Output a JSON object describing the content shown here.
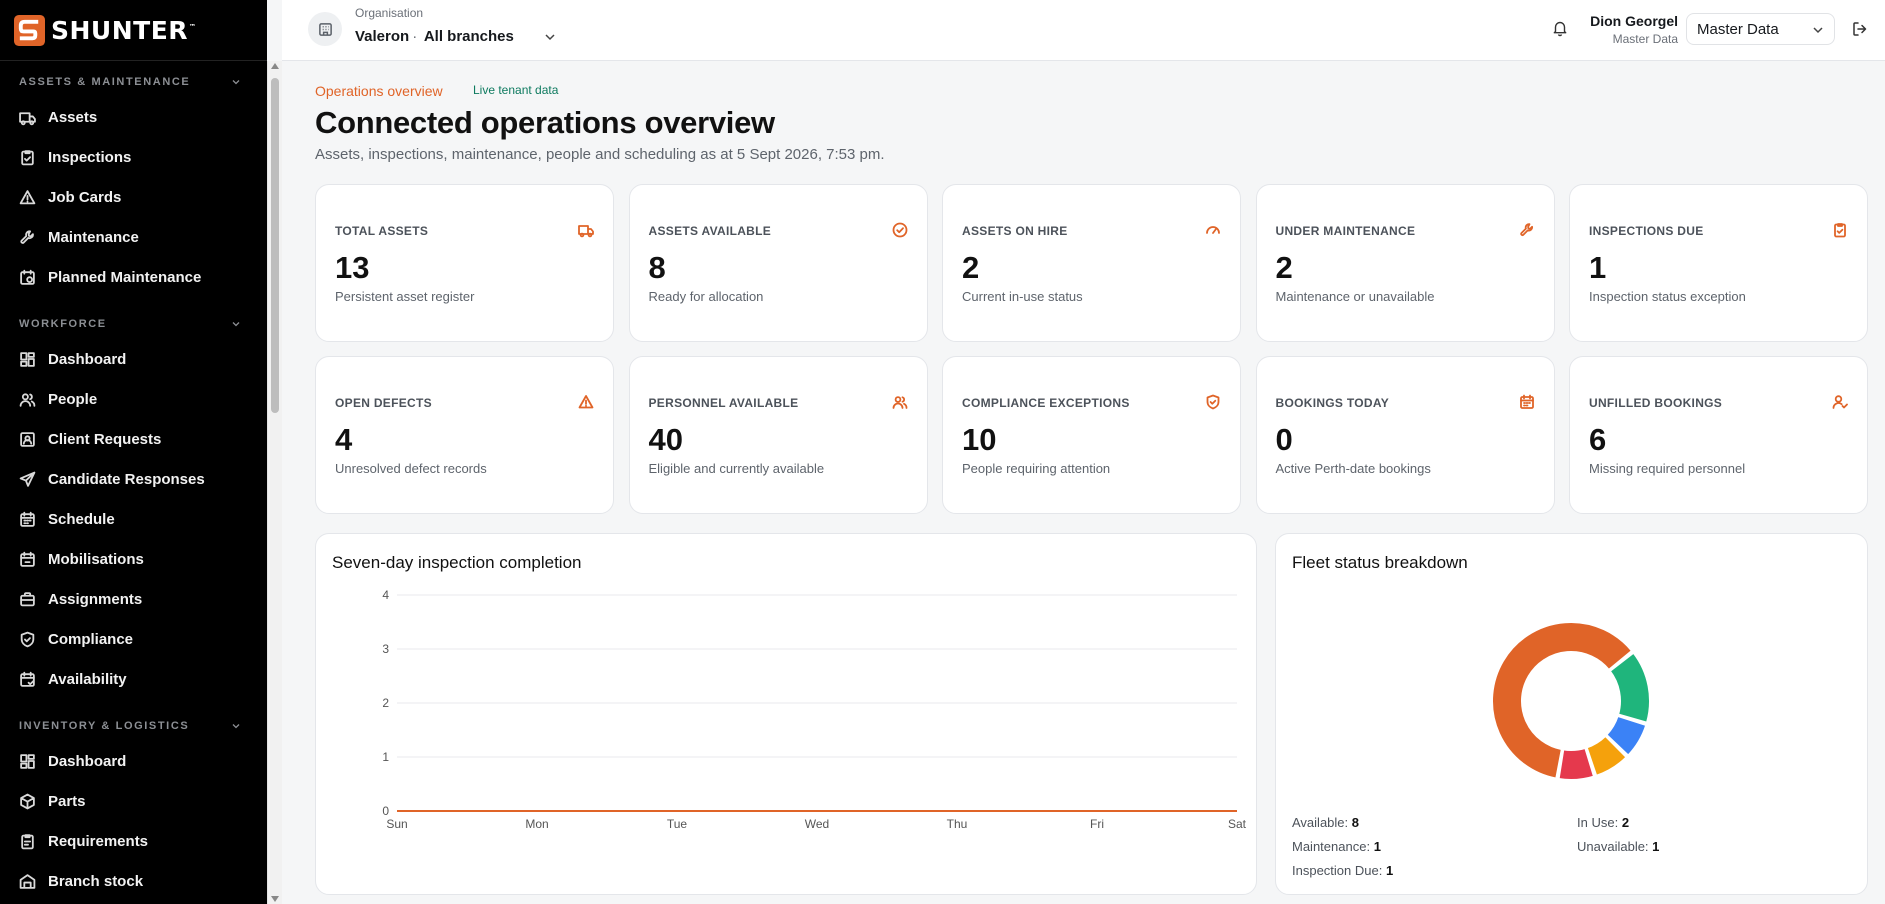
{
  "brand": {
    "name": "SHUNTER",
    "tm": "™",
    "accent": "#e06428"
  },
  "topbar": {
    "org_label": "Organisation",
    "org_name": "Valeron",
    "org_separator": "·",
    "branch": "All branches",
    "user_name": "Dion Georgel",
    "user_role": "Master Data",
    "role_selected": "Master Data"
  },
  "sidebar": {
    "sections": [
      {
        "title": "ASSETS & MAINTENANCE",
        "items": [
          "Assets",
          "Inspections",
          "Job Cards",
          "Maintenance",
          "Planned Maintenance"
        ]
      },
      {
        "title": "WORKFORCE",
        "items": [
          "Dashboard",
          "People",
          "Client Requests",
          "Candidate Responses",
          "Schedule",
          "Mobilisations",
          "Assignments",
          "Compliance",
          "Availability"
        ]
      },
      {
        "title": "INVENTORY & LOGISTICS",
        "items": [
          "Dashboard",
          "Parts",
          "Requirements",
          "Branch stock"
        ]
      }
    ]
  },
  "header": {
    "eyebrow": "Operations overview",
    "badge": "Live tenant data",
    "title": "Connected operations overview",
    "subtitle": "Assets, inspections, maintenance, people and scheduling as at 5 Sept 2026, 7:53 pm."
  },
  "stats": [
    {
      "label": "TOTAL ASSETS",
      "value": "13",
      "desc": "Persistent asset register",
      "icon": "truck-icon"
    },
    {
      "label": "ASSETS AVAILABLE",
      "value": "8",
      "desc": "Ready for allocation",
      "icon": "check-circle-icon"
    },
    {
      "label": "ASSETS ON HIRE",
      "value": "2",
      "desc": "Current in-use status",
      "icon": "gauge-icon"
    },
    {
      "label": "UNDER MAINTENANCE",
      "value": "2",
      "desc": "Maintenance or unavailable",
      "icon": "wrench-icon"
    },
    {
      "label": "INSPECTIONS DUE",
      "value": "1",
      "desc": "Inspection status exception",
      "icon": "clipboard-icon"
    },
    {
      "label": "OPEN DEFECTS",
      "value": "4",
      "desc": "Unresolved defect records",
      "icon": "warning-icon"
    },
    {
      "label": "PERSONNEL AVAILABLE",
      "value": "40",
      "desc": "Eligible and currently available",
      "icon": "users-icon"
    },
    {
      "label": "COMPLIANCE EXCEPTIONS",
      "value": "10",
      "desc": "People requiring attention",
      "icon": "shield-icon"
    },
    {
      "label": "BOOKINGS TODAY",
      "value": "0",
      "desc": "Active Perth-date bookings",
      "icon": "calendar-icon"
    },
    {
      "label": "UNFILLED BOOKINGS",
      "value": "6",
      "desc": "Missing required personnel",
      "icon": "user-check-icon"
    }
  ],
  "chart_data": [
    {
      "type": "line",
      "title": "Seven-day inspection completion",
      "categories": [
        "Sun",
        "Mon",
        "Tue",
        "Wed",
        "Thu",
        "Fri",
        "Sat"
      ],
      "series": [
        {
          "values": [
            0,
            0,
            0,
            0,
            0,
            0,
            0
          ],
          "color": "#e06428"
        }
      ],
      "yticks": [
        0,
        1,
        2,
        3,
        4
      ],
      "ylim": [
        0,
        4
      ],
      "grid": true
    },
    {
      "type": "pie",
      "title": "Fleet status breakdown",
      "slices": [
        {
          "name": "Available",
          "value": 8,
          "color": "#e06428"
        },
        {
          "name": "In Use",
          "value": 2,
          "color": "#1fb57c"
        },
        {
          "name": "Unavailable",
          "value": 1,
          "color": "#3b82f6"
        },
        {
          "name": "Maintenance",
          "value": 1,
          "color": "#f5a10c"
        },
        {
          "name": "Inspection Due",
          "value": 1,
          "color": "#e5394d"
        }
      ],
      "legend": [
        {
          "label": "Available:",
          "value": "8"
        },
        {
          "label": "In Use:",
          "value": "2"
        },
        {
          "label": "Maintenance:",
          "value": "1"
        },
        {
          "label": "Unavailable:",
          "value": "1"
        },
        {
          "label": "Inspection Due:",
          "value": "1"
        }
      ]
    }
  ]
}
